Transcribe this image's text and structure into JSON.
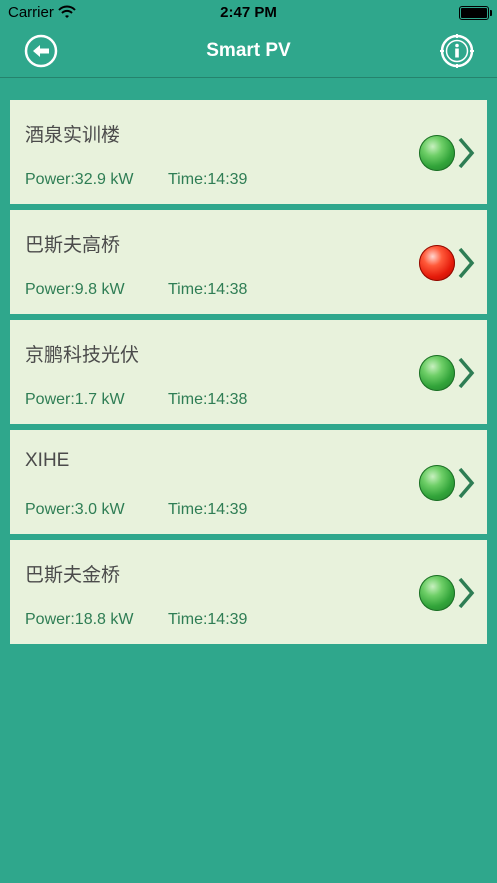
{
  "status_bar": {
    "carrier": "Carrier",
    "time": "2:47 PM"
  },
  "header": {
    "title": "Smart PV",
    "back_icon": "back-arrow-circle-icon",
    "info_icon": "info-circle-icon"
  },
  "colors": {
    "background": "#2fa78c",
    "card": "#e8f2dc",
    "text_green": "#2e7d54",
    "status_ok": "#32a43a",
    "status_fault": "#e41a0a"
  },
  "stations": [
    {
      "name": "酒泉实训楼",
      "power": "Power:32.9 kW",
      "time": "Time:14:39",
      "status": "green"
    },
    {
      "name": "巴斯夫高桥",
      "power": "Power:9.8 kW",
      "time": "Time:14:38",
      "status": "red"
    },
    {
      "name": "京鹏科技光伏",
      "power": "Power:1.7 kW",
      "time": "Time:14:38",
      "status": "green"
    },
    {
      "name": "XIHE",
      "power": "Power:3.0 kW",
      "time": "Time:14:39",
      "status": "green"
    },
    {
      "name": "巴斯夫金桥",
      "power": "Power:18.8 kW",
      "time": "Time:14:39",
      "status": "green"
    }
  ]
}
